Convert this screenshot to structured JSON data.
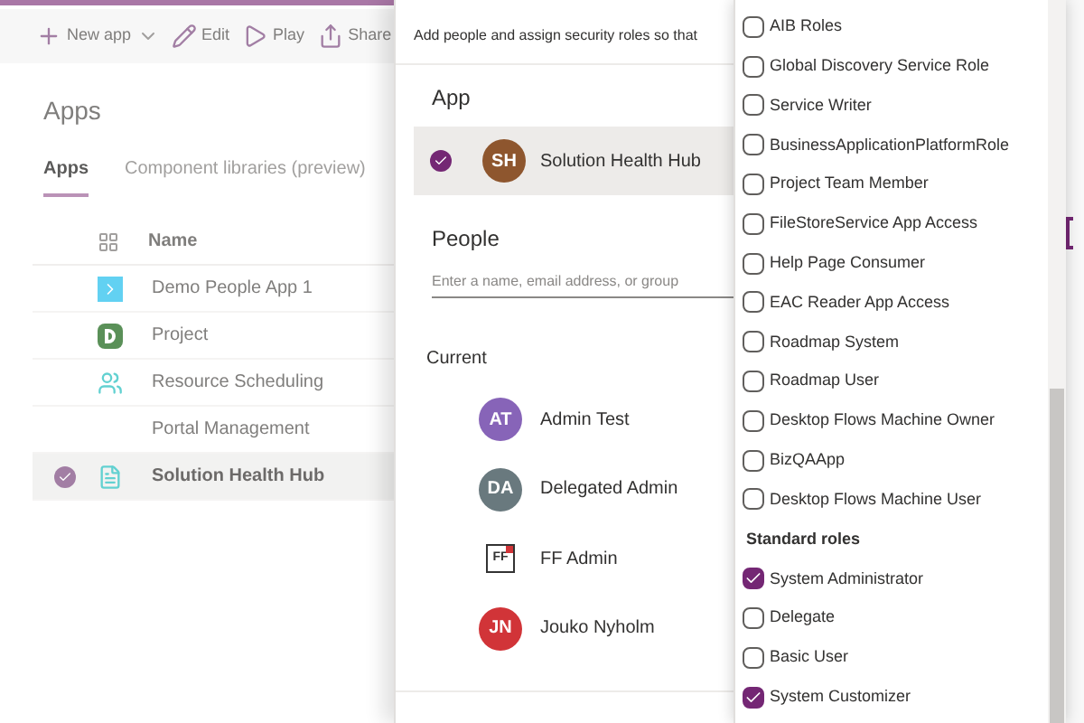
{
  "toolbar": [
    {
      "kind": "new",
      "label": "New app"
    },
    {
      "kind": "edit",
      "label": "Edit"
    },
    {
      "kind": "play",
      "label": "Play"
    },
    {
      "kind": "share",
      "label": "Share"
    }
  ],
  "page_title": "Apps",
  "tabs": [
    {
      "label": "Apps",
      "selected": true
    },
    {
      "label": "Component libraries (preview)",
      "selected": false
    }
  ],
  "table": {
    "columns": [
      "Name"
    ],
    "rows": [
      {
        "kind": "people",
        "name": "Demo People App 1",
        "selected": false
      },
      {
        "kind": "project",
        "name": "Project",
        "selected": false
      },
      {
        "kind": "scheduling",
        "name": "Resource Scheduling",
        "selected": false
      },
      {
        "kind": "none",
        "name": "Portal Management",
        "selected": false
      },
      {
        "kind": "document",
        "name": "Solution Health Hub",
        "selected": true
      }
    ]
  },
  "share_panel": {
    "subtitle": "Add people and assign security roles so that",
    "app_heading": "App",
    "app": {
      "initials": "SH",
      "name": "Solution Health Hub",
      "selected": true,
      "color": "#8e562e"
    },
    "people_heading": "People",
    "people_placeholder": "Enter a name, email address, or group",
    "current_heading": "Current",
    "current": [
      {
        "kind": "avatar",
        "initials": "AT",
        "name": "Admin Test",
        "color": "#8764b8"
      },
      {
        "kind": "avatar",
        "initials": "DA",
        "name": "Delegated Admin",
        "color": "#69797e"
      },
      {
        "kind": "logo",
        "initials": "FF",
        "name": "FF Admin",
        "color": "#d13438"
      },
      {
        "kind": "avatar",
        "initials": "JN",
        "name": "Jouko Nyholm",
        "color": "#d13438"
      }
    ]
  },
  "roles": [
    {
      "kind": "option",
      "label": "AIB Roles",
      "checked": false
    },
    {
      "kind": "option",
      "label": "Global Discovery Service Role",
      "checked": false
    },
    {
      "kind": "option",
      "label": "Service Writer",
      "checked": false
    },
    {
      "kind": "option",
      "label": "BusinessApplicationPlatformRole",
      "checked": false
    },
    {
      "kind": "option",
      "label": "Project Team Member",
      "checked": false
    },
    {
      "kind": "option",
      "label": "FileStoreService App Access",
      "checked": false
    },
    {
      "kind": "option",
      "label": "Help Page Consumer",
      "checked": false
    },
    {
      "kind": "option",
      "label": "EAC Reader App Access",
      "checked": false
    },
    {
      "kind": "option",
      "label": "Roadmap System",
      "checked": false
    },
    {
      "kind": "option",
      "label": "Roadmap User",
      "checked": false
    },
    {
      "kind": "option",
      "label": "Desktop Flows Machine Owner",
      "checked": false
    },
    {
      "kind": "option",
      "label": "BizQAApp",
      "checked": false
    },
    {
      "kind": "option",
      "label": "Desktop Flows Machine User",
      "checked": false
    },
    {
      "kind": "header",
      "label": "Standard roles"
    },
    {
      "kind": "option",
      "label": "System Administrator",
      "checked": true
    },
    {
      "kind": "option",
      "label": "Delegate",
      "checked": false
    },
    {
      "kind": "option",
      "label": "Basic User",
      "checked": false
    },
    {
      "kind": "option",
      "label": "System Customizer",
      "checked": true
    }
  ]
}
